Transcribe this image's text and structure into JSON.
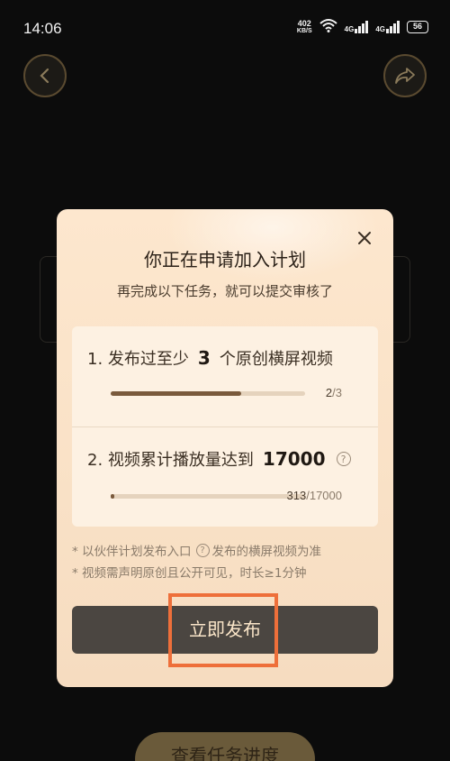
{
  "status_bar": {
    "time": "14:06",
    "net_speed_value": "402",
    "net_speed_unit": "KB/S",
    "signal_1_label": "4G",
    "signal_2_label": "4G",
    "battery": "56"
  },
  "background": {
    "bottom_button_label": "查看任务进度"
  },
  "modal": {
    "title": "你正在申请加入计划",
    "subtitle": "再完成以下任务，就可以提交审核了",
    "tasks": [
      {
        "prefix": "1. 发布过至少",
        "number": "3",
        "suffix": "个原创横屏视频",
        "progress_current": "2",
        "progress_total": "/3",
        "progress_fraction": 0.67
      },
      {
        "prefix": "2. 视频累计播放量达到",
        "number": "17000",
        "suffix": "",
        "progress_current": "313",
        "progress_total": "/17000",
        "progress_fraction": 0.018
      }
    ],
    "note_1_before": "* 以伙伴计划发布入口",
    "note_1_after": "发布的横屏视频为准",
    "note_2": "* 视频需声明原创且公开可见，时长≥1分钟",
    "publish_button_label": "立即发布"
  },
  "colors": {
    "modal_bg": "#fde7ce",
    "button_bg": "#4b4641",
    "button_text": "#fbe6c9",
    "progress_fill": "#7a5a3c",
    "highlight": "#ee6f3a"
  },
  "icons": [
    "back-arrow-icon",
    "share-icon",
    "close-icon",
    "help-icon",
    "wifi-icon",
    "battery-icon"
  ]
}
